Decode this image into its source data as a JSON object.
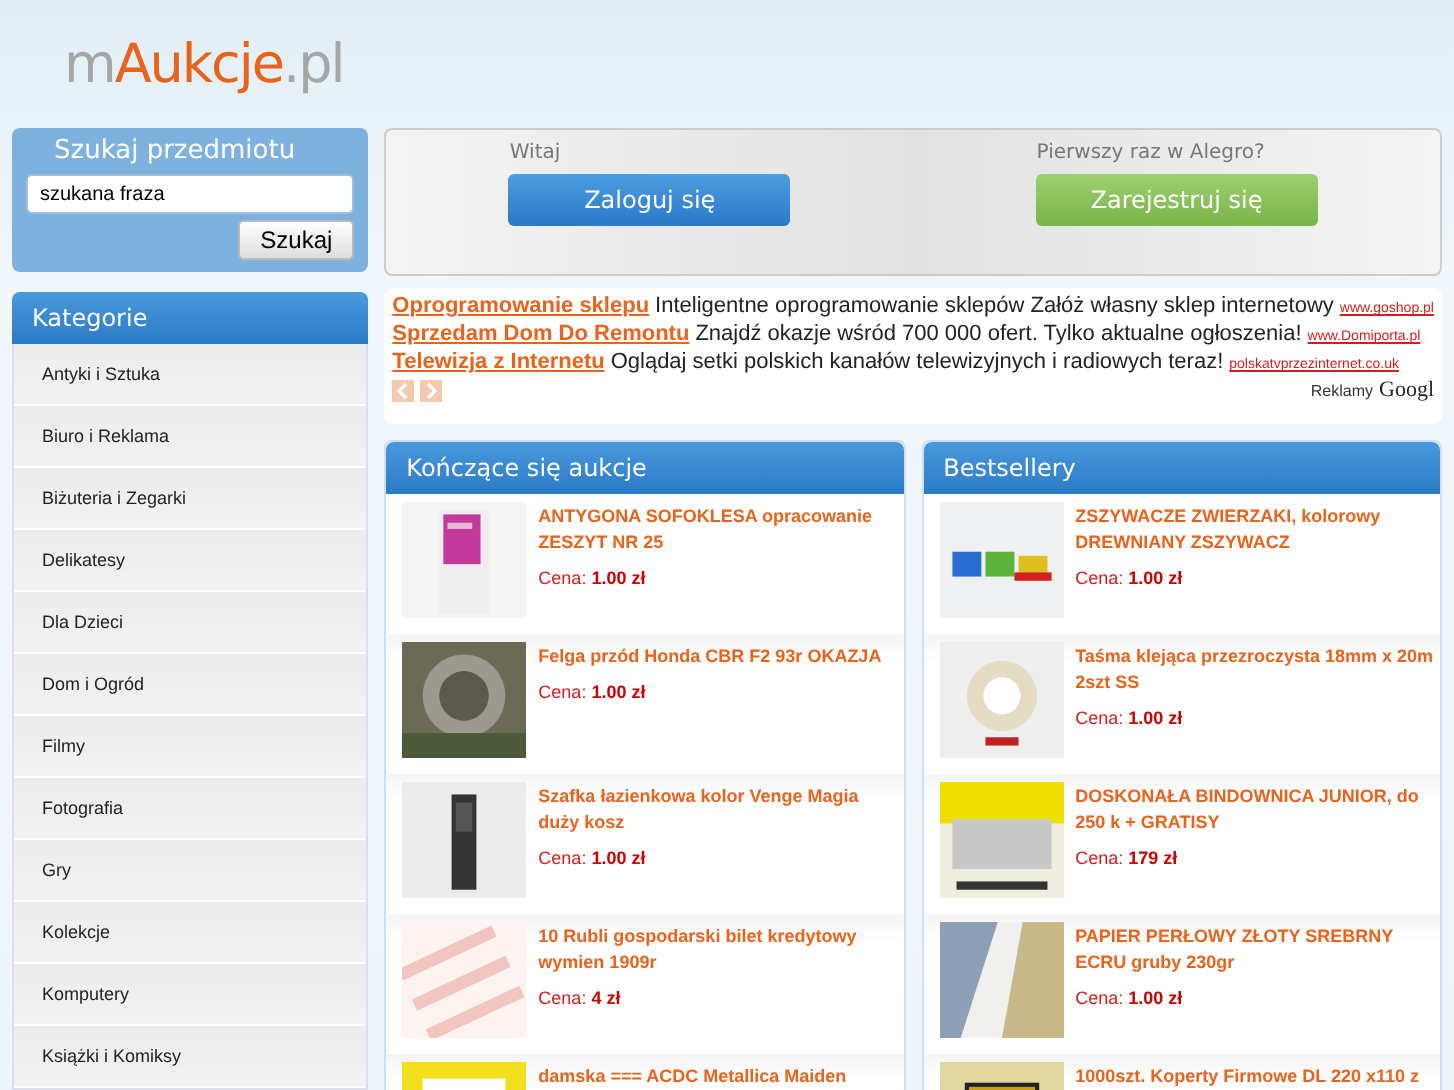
{
  "logo": [
    {
      "text": "m",
      "kind": "plain"
    },
    {
      "text": "Aukcje",
      "kind": "accent"
    },
    {
      "text": ".pl",
      "kind": "plain"
    }
  ],
  "search": {
    "title": "Szukaj przedmiotu",
    "value": "szukana fraza",
    "button": "Szukaj"
  },
  "welcome": {
    "login_label": "Witaj",
    "login_button": "Zaloguj się",
    "register_label": "Pierwszy raz w Alegro?",
    "register_button": "Zarejestruj się"
  },
  "categories": {
    "title": "Kategorie",
    "items": [
      "Antyki i Sztuka",
      "Biuro i Reklama",
      "Biżuteria i Zegarki",
      "Delikatesy",
      "Dla Dzieci",
      "Dom i Ogród",
      "Filmy",
      "Fotografia",
      "Gry",
      "Kolekcje",
      "Komputery",
      "Książki i Komiksy"
    ]
  },
  "ads": {
    "items": [
      {
        "title": "Oprogramowanie sklepu",
        "text": "Inteligentne oprogramowanie sklepów Załóż własny sklep internetowy",
        "url": "www.goshop.pl"
      },
      {
        "title": "Sprzedam Dom Do Remontu",
        "text": "Znajdź okazje wśród 700 000 ofert. Tylko aktualne ogłoszenia!",
        "url": "www.Domiporta.pl"
      },
      {
        "title": "Telewizja z Internetu",
        "text": "Oglądaj setki polskich kanałów telewizyjnych i radiowych teraz!",
        "url": "polskatvprzezinternet.co.uk"
      }
    ],
    "label": "Reklamy",
    "brand": "Googl"
  },
  "panels": [
    {
      "title": "Kończące się aukcje",
      "items": [
        {
          "title": "ANTYGONA SOFOKLESA opracowanie ZESZYT NR 25",
          "price_label": "Cena:",
          "price": "1.00 zł"
        },
        {
          "title": "Felga przód Honda CBR F2 93r OKAZJA",
          "price_label": "Cena:",
          "price": "1.00 zł"
        },
        {
          "title": "Szafka łazienkowa kolor Venge Magia duży kosz",
          "price_label": "Cena:",
          "price": "1.00 zł"
        },
        {
          "title": "10 Rubli gospodarski bilet kredytowy wymien 1909r",
          "price_label": "Cena:",
          "price": "4 zł"
        },
        {
          "title": "damska === ACDC Metallica Maiden"
        }
      ]
    },
    {
      "title": "Bestsellery",
      "items": [
        {
          "title": "ZSZYWACZE ZWIERZAKI, kolorowy DREWNIANY ZSZYWACZ",
          "price_label": "Cena:",
          "price": "1.00 zł"
        },
        {
          "title": "Taśma klejąca przezroczysta 18mm x 20m 2szt SS",
          "price_label": "Cena:",
          "price": "1.00 zł"
        },
        {
          "title": "DOSKONAŁA BINDOWNICA JUNIOR, do 250 k + GRATISY",
          "price_label": "Cena:",
          "price": "179 zł"
        },
        {
          "title": "PAPIER PERŁOWY ZŁOTY SREBRNY ECRU gruby 230gr",
          "price_label": "Cena:",
          "price": "1.00 zł"
        },
        {
          "title": "1000szt. Koperty Firmowe DL 220 x110 z"
        }
      ]
    }
  ]
}
